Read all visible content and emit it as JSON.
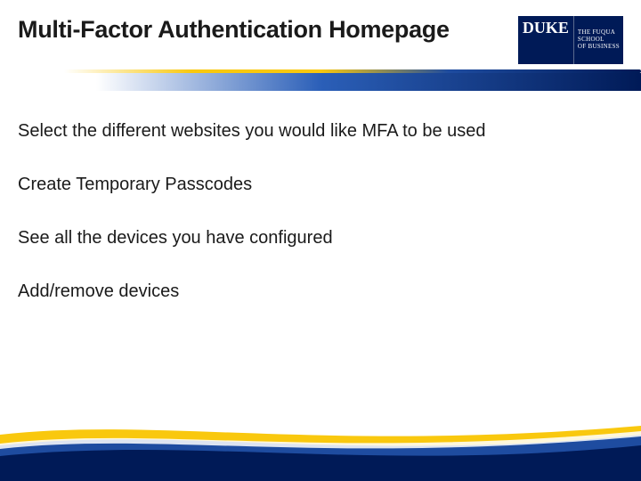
{
  "header": {
    "title": "Multi-Factor Authentication Homepage",
    "logo": {
      "duke": "DUKE",
      "fuqua_line1": "THE FUQUA",
      "fuqua_line2": "SCHOOL",
      "fuqua_line3": "OF BUSINESS"
    }
  },
  "bullets": [
    "Select the different websites you would like MFA to be used",
    "Create Temporary Passcodes",
    "See all the devices you have configured",
    "Add/remove devices"
  ],
  "colors": {
    "duke_blue": "#001a57",
    "accent_yellow": "#f9c80e",
    "mid_blue": "#2b5fb8"
  }
}
